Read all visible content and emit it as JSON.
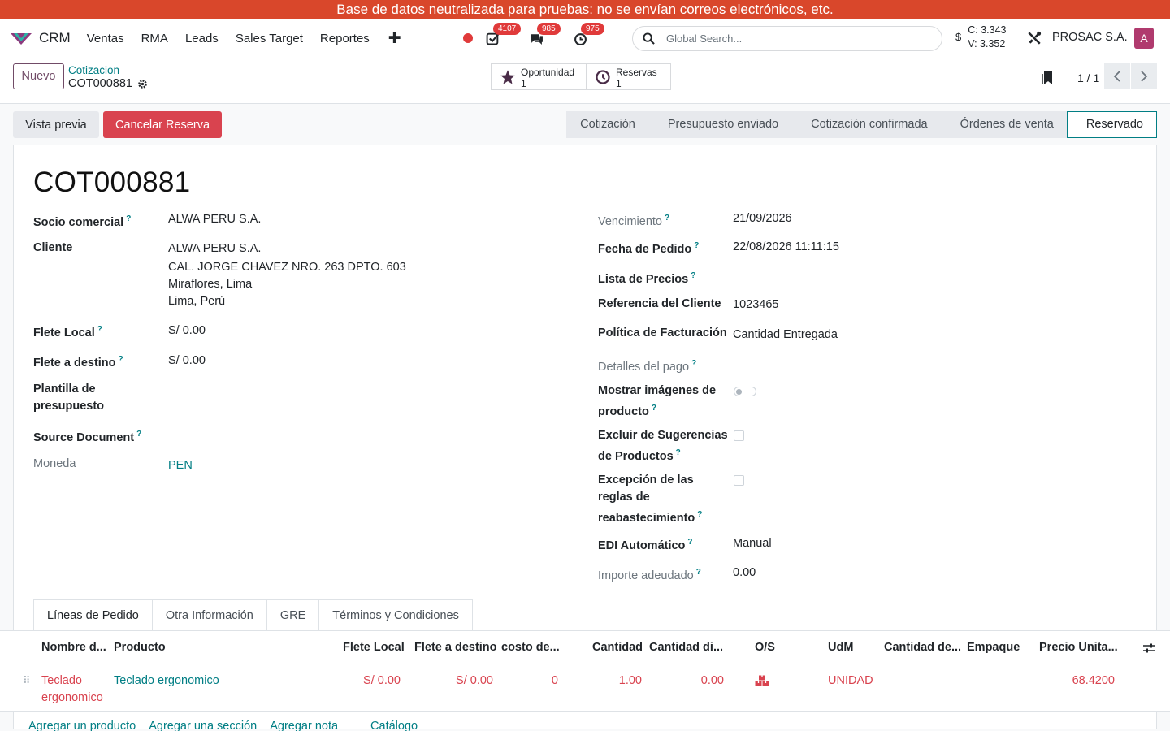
{
  "banner": "Base de datos neutralizada para pruebas: no se envían correos electrónicos, etc.",
  "nav": {
    "app_name": "CRM",
    "menu": [
      "Ventas",
      "RMA",
      "Leads",
      "Sales Target",
      "Reportes"
    ],
    "badges": {
      "activities": "4107",
      "messages": "985",
      "clock": "975"
    },
    "search_placeholder": "Global Search...",
    "currency": {
      "symbol": "$",
      "buy": "C: 3.343",
      "sell": "V: 3.352"
    },
    "company": "PROSAC S.A.",
    "avatar_letter": "A",
    "icons": {
      "logo": "odoo-logo-icon",
      "add": "plus-icon",
      "record": "record-dot-icon",
      "activities": "check-square-icon",
      "messages": "chat-icon",
      "clock": "clock-icon",
      "search": "search-icon",
      "tools": "tools-icon"
    }
  },
  "control": {
    "new_label": "Nuevo",
    "breadcrumb_parent": "Cotizacion",
    "breadcrumb_current": "COT000881",
    "smart_buttons": [
      {
        "label": "Oportunidad",
        "count": "1"
      },
      {
        "label": "Reservas",
        "count": "1"
      }
    ],
    "pager": "1 / 1"
  },
  "actions": {
    "preview": "Vista previa",
    "cancel": "Cancelar Reserva"
  },
  "stages": [
    "Cotización",
    "Presupuesto enviado",
    "Cotización confirmada",
    "Órdenes de venta",
    "Reservado"
  ],
  "active_stage": "Reservado",
  "form": {
    "title": "COT000881",
    "left": {
      "partner_label": "Socio comercial",
      "partner": "ALWA PERU S.A.",
      "client_label": "Cliente",
      "client_lines": [
        "ALWA PERU S.A.",
        "CAL. JORGE CHAVEZ NRO. 263 DPTO. 603",
        "Miraflores, Lima",
        "Lima, Perú"
      ],
      "local_freight_label": "Flete Local",
      "local_freight": "S/ 0.00",
      "dest_freight_label": "Flete a destino",
      "dest_freight": "S/ 0.00",
      "template_label_1": "Plantilla de",
      "template_label_2": "presupuesto",
      "source_label": "Source Document",
      "currency_label": "Moneda",
      "currency": "PEN"
    },
    "right": {
      "expiry_label": "Vencimiento",
      "expiry": "21/09/2026",
      "order_date_label": "Fecha de Pedido",
      "order_date": "22/08/2026 11:11:15",
      "pricelist_label": "Lista de Precios",
      "client_ref_label": "Referencia del Cliente",
      "client_ref": "1023465",
      "invoice_policy_label": "Política de Facturación",
      "invoice_policy": "Cantidad Entregada",
      "payment_details_label": "Detalles del pago",
      "show_images_label_1": "Mostrar imágenes de",
      "show_images_label_2": "producto",
      "exclude_label_1": "Excluir de Sugerencias",
      "exclude_label_2": "de Productos",
      "exception_label_1": "Excepción de las",
      "exception_label_2": "reglas de",
      "exception_label_3": "reabastecimiento",
      "edi_label": "EDI Automático",
      "edi": "Manual",
      "due_label": "Importe adeudado",
      "due": "0.00"
    }
  },
  "tabs": [
    "Líneas de Pedido",
    "Otra Información",
    "GRE",
    "Términos y Condiciones"
  ],
  "lines": {
    "headers": [
      "Nombre d...",
      "Producto",
      "Flete Local",
      "Flete a destino",
      "costo de...",
      "Cantidad",
      "Cantidad di...",
      "O/S",
      "UdM",
      "Cantidad de...",
      "Empaque",
      "Precio Unita..."
    ],
    "rows": [
      {
        "name_1": "Teclado",
        "name_2": "ergonomico",
        "product": "Teclado ergonomico",
        "local": "S/ 0.00",
        "dest": "S/ 0.00",
        "cost": "0",
        "qty": "1.00",
        "qty_avail": "0.00",
        "uom": "UNIDAD",
        "price": "68.4200"
      }
    ],
    "add_links": [
      "Agregar un producto",
      "Agregar una sección",
      "Agregar nota",
      "Catálogo"
    ]
  },
  "colors": {
    "banner": "#d9472b",
    "primary": "#714b67",
    "teal": "#017e84",
    "danger": "#d9434f"
  }
}
